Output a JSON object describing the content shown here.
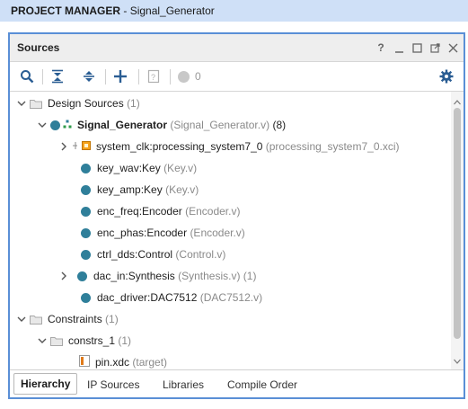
{
  "header": {
    "section": "PROJECT MANAGER",
    "separator": " - ",
    "project": "Signal_Generator"
  },
  "panel": {
    "title": "Sources",
    "controls": [
      "?",
      "minimize",
      "restore",
      "float",
      "close"
    ],
    "help_label": "?"
  },
  "toolbar": {
    "icons": [
      "search-icon",
      "collapse-all-icon",
      "expand-all-icon",
      "add-icon",
      "properties-icon",
      "status-circle-icon",
      "gear-icon"
    ],
    "status_count": "0"
  },
  "tree": {
    "design_sources": {
      "label": "Design Sources",
      "count": "(1)"
    },
    "top": {
      "name": "Signal_Generator",
      "file": "(Signal_Generator.v)",
      "count": "(8)"
    },
    "children": [
      {
        "inst": "system_clk",
        "module": "processing_system7_0",
        "file": "(processing_system7_0.xci)"
      },
      {
        "inst": "key_wav",
        "module": "Key",
        "file": "(Key.v)"
      },
      {
        "inst": "key_amp",
        "module": "Key",
        "file": "(Key.v)"
      },
      {
        "inst": "enc_freq",
        "module": "Encoder",
        "file": "(Encoder.v)"
      },
      {
        "inst": "enc_phas",
        "module": "Encoder",
        "file": "(Encoder.v)"
      },
      {
        "inst": "ctrl_dds",
        "module": "Control",
        "file": "(Control.v)"
      },
      {
        "inst": "dac_in",
        "module": "Synthesis",
        "file": "(Synthesis.v)",
        "count": "(1)"
      },
      {
        "inst": "dac_driver",
        "module": "DAC7512",
        "file": "(DAC7512.v)"
      }
    ],
    "constraints": {
      "label": "Constraints",
      "count": "(1)"
    },
    "constrs": {
      "label": "constrs_1",
      "count": "(1)"
    },
    "xdc": {
      "name": "pin.xdc",
      "tag": "(target)"
    },
    "separator": " : "
  },
  "tabs": [
    "Hierarchy",
    "IP Sources",
    "Libraries",
    "Compile Order"
  ],
  "colors": {
    "accent": "#5a8fd6",
    "header_bg": "#cfe0f7",
    "module_dot": "#2f7f9a",
    "gray_text": "#8a8a8a"
  }
}
